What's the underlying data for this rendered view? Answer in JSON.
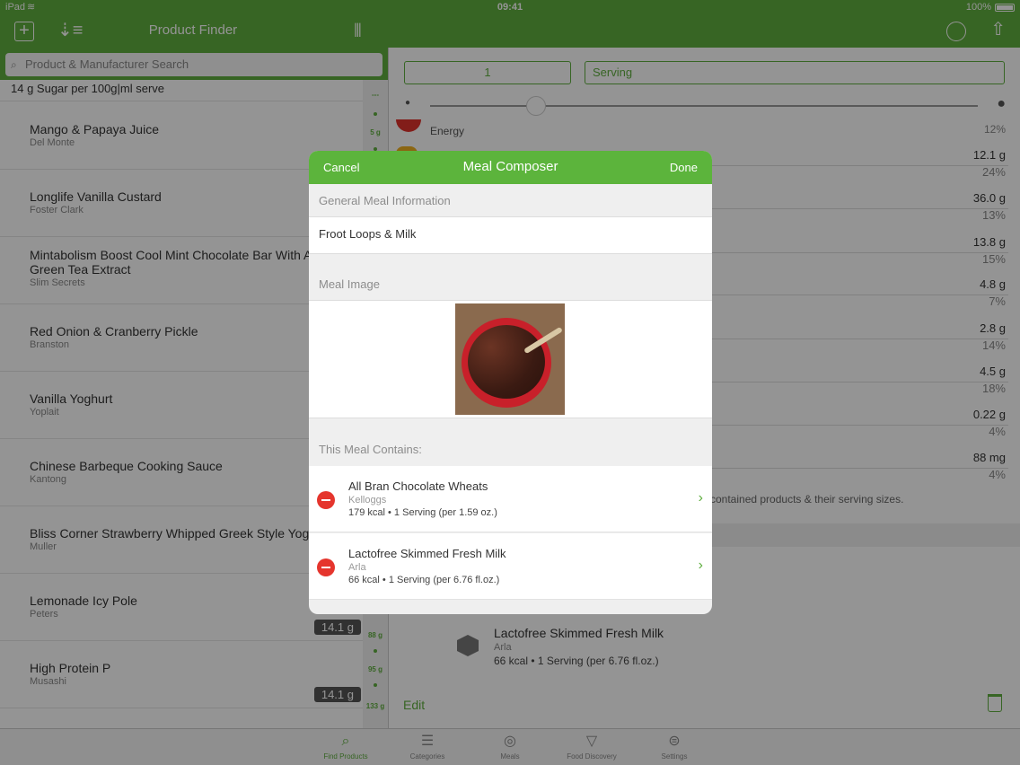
{
  "status": {
    "carrier": "iPad",
    "time": "09:41",
    "battery": "100%"
  },
  "nav": {
    "title": "Product Finder"
  },
  "search": {
    "placeholder": "Product & Manufacturer Search"
  },
  "list": {
    "header": "14 g Sugar per 100g|ml serve",
    "items": [
      {
        "name": "Mango & Papaya Juice",
        "maker": "Del Monte"
      },
      {
        "name": "Longlife Vanilla Custard",
        "maker": "Foster Clark"
      },
      {
        "name": "Mintabolism Boost Cool Mint Chocolate Bar With Acai & Green Tea Extract",
        "name_line2": "Green Tea Extract",
        "maker": "Slim Secrets"
      },
      {
        "name": "Red Onion & Cranberry Pickle",
        "maker": "Branston"
      },
      {
        "name": "Vanilla Yoghurt",
        "maker": "Yoplait"
      },
      {
        "name": "Chinese Barbeque Cooking Sauce",
        "maker": "Kantong"
      },
      {
        "name": "Bliss Corner Strawberry Whipped Greek Style Yogurt",
        "maker": "Muller"
      },
      {
        "name": "Lemonade Icy Pole",
        "maker": "Peters",
        "badge": "14.1 g"
      },
      {
        "name": "High Protein P",
        "maker": "Musashi",
        "badge": "14.1 g"
      }
    ],
    "index_labels": [
      "---",
      "5 g",
      "88 g",
      "95 g",
      "133 g"
    ]
  },
  "detail": {
    "qty_value": "1",
    "serving_label": "Serving",
    "energy_label": "Energy",
    "energy_pct": "12%",
    "nutrients": [
      {
        "value": "12.1 g",
        "pct": "24%"
      },
      {
        "value": "36.0 g",
        "pct": "13%"
      },
      {
        "value": "13.8 g",
        "pct": "15%"
      },
      {
        "value": "4.8 g",
        "pct": "7%"
      },
      {
        "value": "2.8 g",
        "pct": "14%"
      },
      {
        "value": "4.5 g",
        "pct": "18%"
      },
      {
        "value": "0.22 g",
        "pct": "4%"
      },
      {
        "value": "88 mg",
        "pct": "4%"
      }
    ],
    "contained_text": "contained products & their serving sizes.",
    "bg_item": {
      "name": "Lactofree Skimmed Fresh Milk",
      "maker": "Arla",
      "info": "66 kcal  •  1 Serving (per 6.76 fl.oz.)"
    },
    "edit_label": "Edit"
  },
  "modal": {
    "title": "Meal Composer",
    "cancel_label": "Cancel",
    "done_label": "Done",
    "general_section": "General Meal Information",
    "meal_name": "Froot Loops & Milk",
    "image_section": "Meal Image",
    "contains_section": "This Meal Contains:",
    "items": [
      {
        "name": "All Bran Chocolate Wheats",
        "maker": "Kelloggs",
        "info": "179 kcal  •  1 Serving (per 1.59 oz.)"
      },
      {
        "name": "Lactofree Skimmed Fresh Milk",
        "maker": "Arla",
        "info": "66 kcal  •  1 Serving (per 6.76 fl.oz.)"
      }
    ]
  },
  "tabbar": {
    "tabs": [
      {
        "label": "Find Products",
        "icon": "search-icon"
      },
      {
        "label": "Categories",
        "icon": "list-icon"
      },
      {
        "label": "Meals",
        "icon": "plate-icon"
      },
      {
        "label": "Food Discovery",
        "icon": "funnel-icon"
      },
      {
        "label": "Settings",
        "icon": "toggles-icon"
      }
    ]
  },
  "colors": {
    "accent": "#5fae3f",
    "header": "#5cb43c",
    "remove": "#e5352d"
  }
}
